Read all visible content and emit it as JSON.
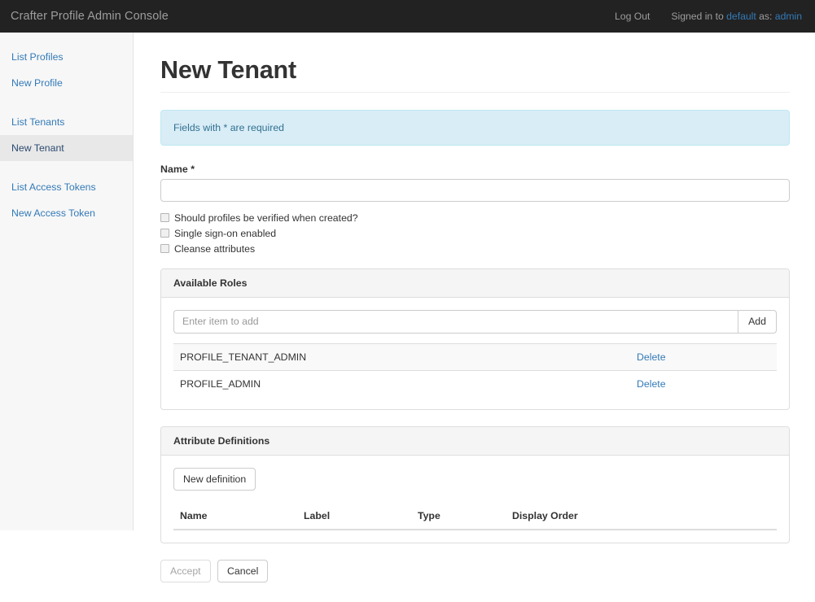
{
  "navbar": {
    "brand": "Crafter Profile Admin Console",
    "logout": "Log Out",
    "signed_in_prefix": "Signed in to",
    "tenant": "default",
    "as_label": "as:",
    "user": "admin",
    "background": "#222222",
    "link_color": "#337ab7"
  },
  "sidebar": {
    "groups": [
      {
        "items": [
          {
            "label": "List Profiles",
            "active": false
          },
          {
            "label": "New Profile",
            "active": false
          }
        ]
      },
      {
        "items": [
          {
            "label": "List Tenants",
            "active": false
          },
          {
            "label": "New Tenant",
            "active": true
          }
        ]
      },
      {
        "items": [
          {
            "label": "List Access Tokens",
            "active": false
          },
          {
            "label": "New Access Token",
            "active": false
          }
        ]
      }
    ]
  },
  "page": {
    "title": "New Tenant",
    "alert": "Fields with * are required"
  },
  "form": {
    "name_label": "Name *",
    "name_value": "",
    "name_placeholder": "",
    "checkboxes": [
      {
        "label": "Should profiles be verified when created?",
        "checked": false
      },
      {
        "label": "Single sign-on enabled",
        "checked": false
      },
      {
        "label": "Cleanse attributes",
        "checked": false
      }
    ]
  },
  "roles_panel": {
    "title": "Available Roles",
    "input_placeholder": "Enter item to add",
    "input_value": "",
    "add_label": "Add",
    "delete_label": "Delete",
    "rows": [
      {
        "role": "PROFILE_TENANT_ADMIN",
        "action": "Delete"
      },
      {
        "role": "PROFILE_ADMIN",
        "action": "Delete"
      }
    ]
  },
  "attributes_panel": {
    "title": "Attribute Definitions",
    "new_definition_label": "New definition",
    "columns": [
      "Name",
      "Label",
      "Type",
      "Display Order"
    ],
    "rows": []
  },
  "actions": {
    "accept": "Accept",
    "cancel": "Cancel",
    "accept_disabled": true
  }
}
